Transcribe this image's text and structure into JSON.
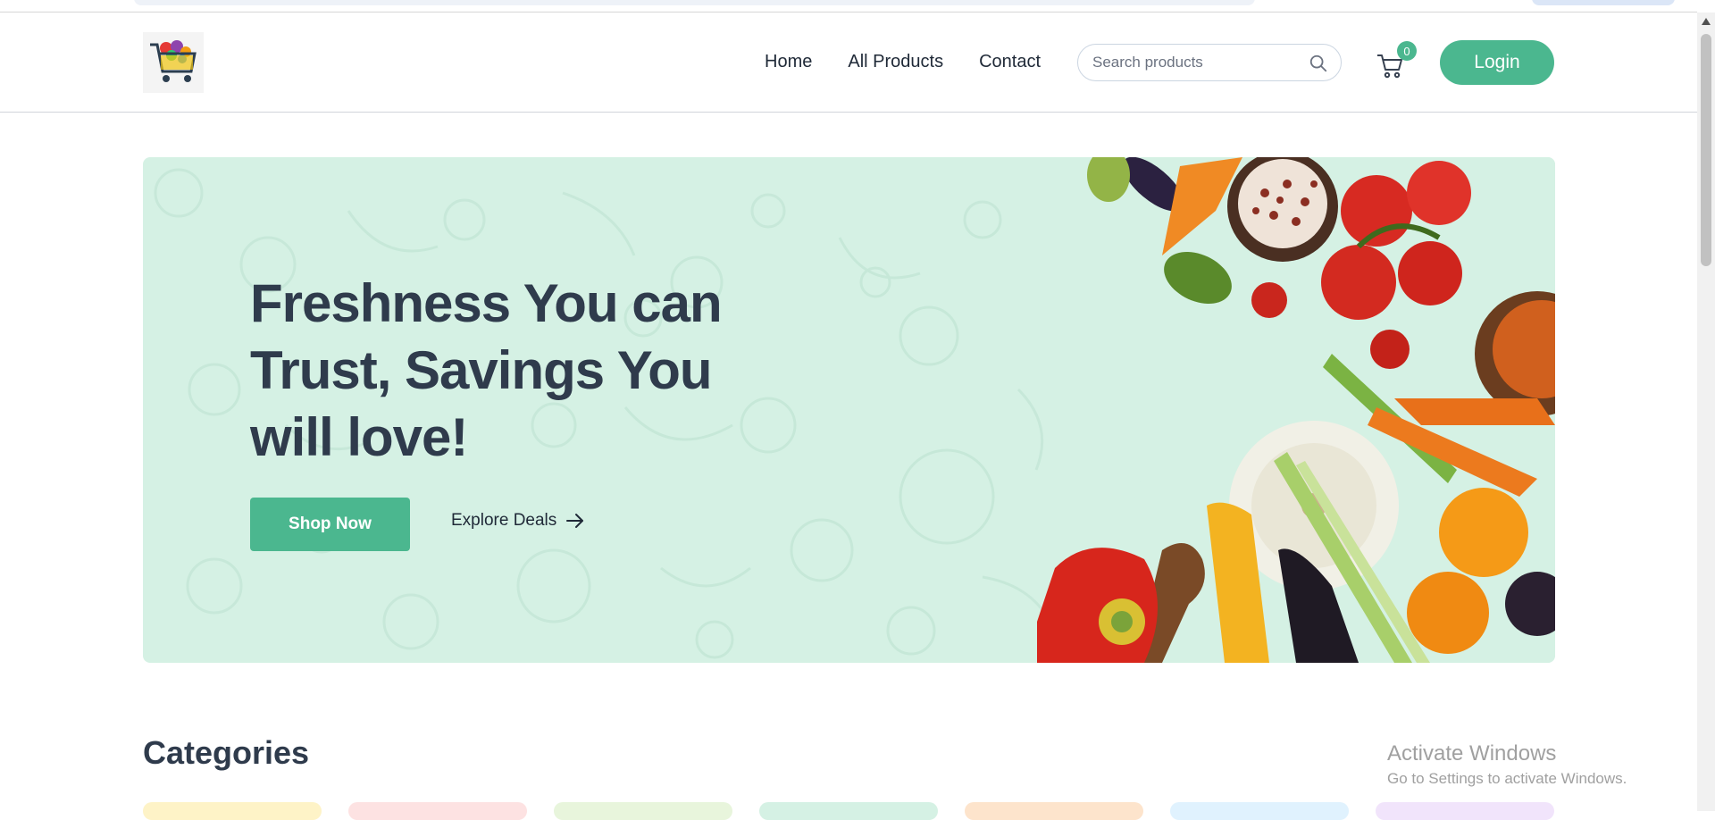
{
  "header": {
    "logo_alt": "shopping-cart-logo",
    "nav": [
      "Home",
      "All Products",
      "Contact"
    ],
    "search_placeholder": "Search products",
    "cart_count": "0",
    "login_label": "Login"
  },
  "hero": {
    "title": "Freshness You can Trust, Savings You will love!",
    "shop_label": "Shop Now",
    "explore_label": "Explore Deals"
  },
  "categories": {
    "title": "Categories",
    "card_colors": [
      "#fef3c7",
      "#fde2e2",
      "#e8f5dc",
      "#d5f1e4",
      "#fde4cc",
      "#e0f2fe",
      "#f1e4fb"
    ]
  },
  "os_overlay": {
    "line1": "Activate Windows",
    "line2": "Go to Settings to activate Windows."
  },
  "colors": {
    "accent": "#4bb78f",
    "hero_bg": "#d5f1e4",
    "heading": "#2f3b4c"
  }
}
